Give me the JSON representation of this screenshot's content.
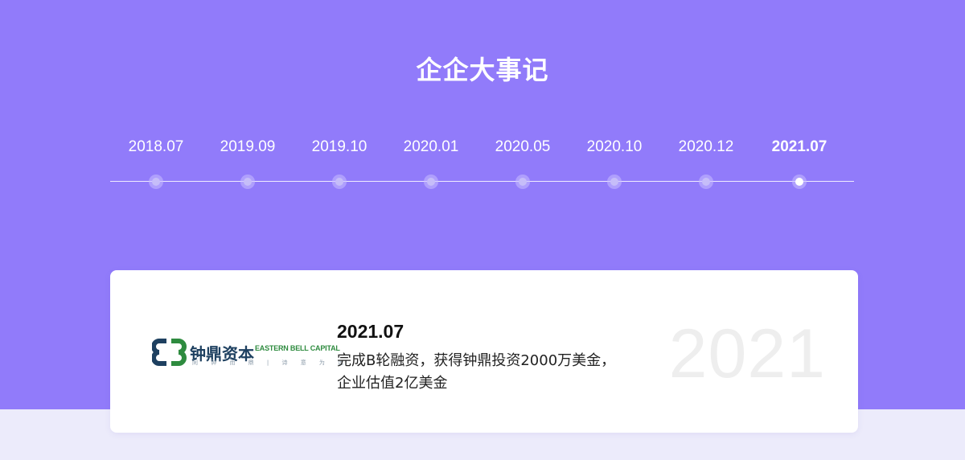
{
  "section": {
    "title": "企企大事记"
  },
  "timeline": {
    "items": [
      {
        "label": "2018.07",
        "active": false
      },
      {
        "label": "2019.09",
        "active": false
      },
      {
        "label": "2019.10",
        "active": false
      },
      {
        "label": "2020.01",
        "active": false
      },
      {
        "label": "2020.05",
        "active": false
      },
      {
        "label": "2020.10",
        "active": false
      },
      {
        "label": "2020.12",
        "active": false
      },
      {
        "label": "2021.07",
        "active": true
      }
    ]
  },
  "card": {
    "logo": {
      "name_cn": "钟鼎资本",
      "name_en": "EASTERN BELL CAPITAL",
      "slogan": "同 钟 而 鼎 | 诗 意 为 远"
    },
    "date": "2021.07",
    "description_line1": "完成B轮融资，获得钟鼎投资2000万美金，",
    "description_line2": "企业估值2亿美金",
    "year_watermark": "2021"
  },
  "colors": {
    "hero_bg": "#917BFA",
    "page_bg": "#ECEBFB",
    "logo_blue": "#1E4060",
    "logo_green": "#2E8B3F"
  }
}
